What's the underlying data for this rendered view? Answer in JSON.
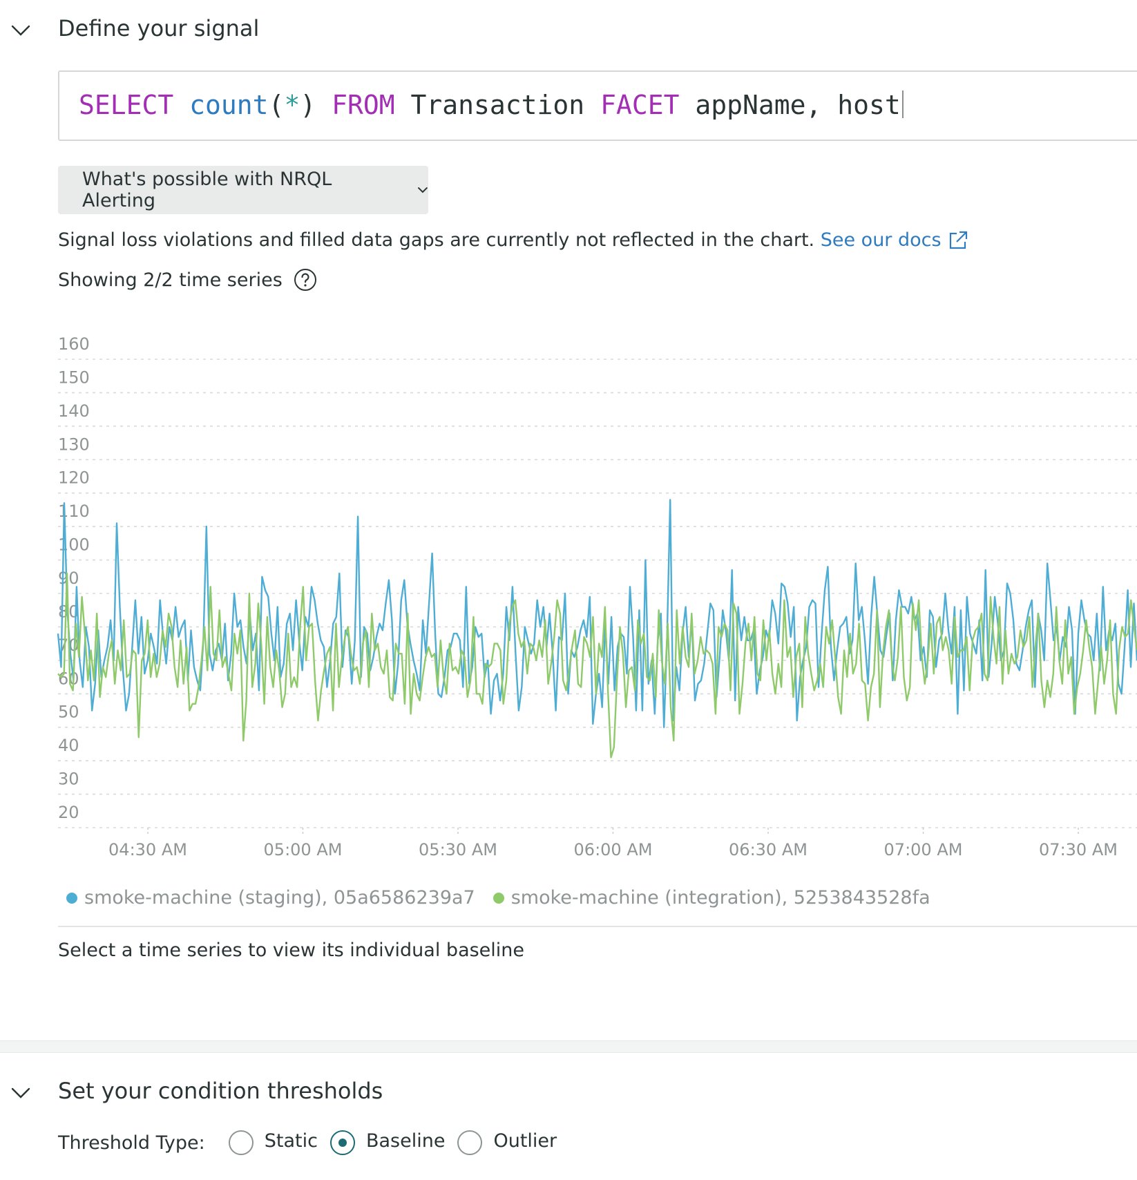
{
  "signal_section": {
    "title": "Define your signal",
    "query": {
      "t1": "SELECT",
      "t2": "count",
      "t3": "(",
      "t4": "*",
      "t5": ")",
      "t6": "FROM",
      "t7": "Transaction",
      "t8": "FACET",
      "t9": "appName, host"
    },
    "nrql_button": "What's possible with NRQL Alerting",
    "note_text": "Signal loss violations and filled data gaps are currently not reflected in the chart.",
    "docs_link": "See our docs",
    "showing_text": "Showing 2/2 time series",
    "select_hint": "Select a time series to view its individual baseline"
  },
  "threshold_section": {
    "title": "Set your condition thresholds",
    "type_label": "Threshold Type:",
    "options": [
      {
        "label": "Static",
        "checked": false
      },
      {
        "label": "Baseline",
        "checked": true
      },
      {
        "label": "Outlier",
        "checked": false
      }
    ]
  },
  "chart_data": {
    "type": "line",
    "y_ticks": [
      "160",
      "150",
      "140",
      "130",
      "120",
      "110",
      "100",
      "90",
      "80",
      "70",
      "60",
      "50",
      "40",
      "30",
      "20"
    ],
    "ylim": [
      20,
      160
    ],
    "x_ticks": [
      "04:30 AM",
      "05:00 AM",
      "05:30 AM",
      "06:00 AM",
      "06:30 AM",
      "07:00 AM",
      "07:30 AM"
    ],
    "grid": true,
    "legend_position": "bottom",
    "series": [
      {
        "name": "smoke-machine (staging), 05a6586239a7",
        "color": "#4eadd4",
        "values": [
          78,
          68,
          117,
          85,
          72,
          64,
          92,
          70,
          62,
          80,
          74,
          55,
          63,
          79,
          65,
          70,
          74,
          82,
          70,
          111,
          86,
          67,
          55,
          60,
          74,
          88,
          72,
          83,
          66,
          70,
          78,
          74,
          69,
          88,
          77,
          69,
          80,
          76,
          86,
          77,
          80,
          82,
          64,
          79,
          68,
          64,
          61,
          76,
          110,
          72,
          67,
          73,
          75,
          70,
          81,
          64,
          72,
          90,
          80,
          82,
          74,
          69,
          84,
          73,
          78,
          61,
          95,
          91,
          89,
          78,
          70,
          86,
          65,
          69,
          81,
          84,
          73,
          88,
          76,
          67,
          83,
          80,
          92,
          88,
          81,
          76,
          74,
          62,
          70,
          81,
          83,
          96,
          68,
          79,
          77,
          63,
          76,
          113,
          65,
          80,
          78,
          67,
          71,
          77,
          81,
          79,
          87,
          94,
          82,
          60,
          69,
          88,
          94,
          81,
          75,
          70,
          66,
          61,
          82,
          72,
          87,
          102,
          78,
          60,
          59,
          65,
          73,
          74,
          78,
          78,
          76,
          62,
          92,
          63,
          68,
          80,
          77,
          78,
          65,
          70,
          54,
          64,
          66,
          58,
          66,
          86,
          76,
          92,
          72,
          55,
          62,
          80,
          76,
          72,
          75,
          88,
          80,
          86,
          74,
          84,
          72,
          55,
          77,
          76,
          90,
          60,
          73,
          71,
          74,
          79,
          82,
          77,
          89,
          51,
          60,
          66,
          56,
          81,
          63,
          83,
          61,
          74,
          78,
          77,
          66,
          92,
          77,
          55,
          85,
          55,
          100,
          63,
          70,
          54,
          76,
          84,
          50,
          77,
          118,
          52,
          68,
          61,
          78,
          86,
          71,
          82,
          58,
          63,
          64,
          69,
          78,
          87,
          85,
          59,
          71,
          85,
          79,
          70,
          97,
          58,
          86,
          76,
          83,
          76,
          76,
          79,
          60,
          67,
          71,
          79,
          76,
          88,
          84,
          75,
          93,
          92,
          87,
          77,
          86,
          52,
          65,
          70,
          74,
          86,
          88,
          87,
          62,
          78,
          91,
          98,
          74,
          64,
          73,
          80,
          81,
          83,
          72,
          76,
          99,
          82,
          86,
          76,
          63,
          83,
          95,
          84,
          73,
          71,
          78,
          84,
          64,
          82,
          91,
          86,
          86,
          84,
          89,
          82,
          84,
          70,
          74,
          65,
          85,
          83,
          68,
          76,
          78,
          90,
          79,
          72,
          86,
          54,
          85,
          61,
          89,
          78,
          75,
          72,
          82,
          64,
          97,
          65,
          75,
          89,
          81,
          70,
          73,
          93,
          90,
          82,
          69,
          67,
          73,
          80,
          85,
          88,
          62,
          84,
          79,
          70,
          99,
          88,
          76,
          80,
          70,
          77,
          74,
          86,
          79,
          54,
          78,
          88,
          82,
          78,
          77,
          70,
          84,
          67,
          92,
          73,
          79,
          76,
          81,
          63,
          60,
          74,
          91,
          68,
          87,
          70
        ]
      },
      {
        "name": "smoke-machine (integration), 5253843528fa",
        "color": "#8ec96a",
        "values": [
          66,
          65,
          66,
          96,
          63,
          61,
          81,
          71,
          89,
          78,
          64,
          73,
          64,
          84,
          59,
          68,
          65,
          72,
          76,
          63,
          73,
          67,
          82,
          65,
          66,
          73,
          72,
          47,
          70,
          72,
          82,
          65,
          72,
          65,
          69,
          79,
          74,
          84,
          80,
          68,
          62,
          76,
          63,
          74,
          55,
          57,
          57,
          62,
          70,
          80,
          67,
          92,
          72,
          70,
          85,
          68,
          71,
          66,
          61,
          78,
          72,
          79,
          46,
          58,
          90,
          62,
          69,
          87,
          75,
          57,
          83,
          68,
          62,
          73,
          67,
          56,
          60,
          78,
          62,
          65,
          62,
          80,
          92,
          70,
          80,
          81,
          64,
          52,
          61,
          67,
          72,
          74,
          55,
          81,
          62,
          71,
          77,
          80,
          72,
          67,
          68,
          63,
          75,
          79,
          62,
          84,
          73,
          75,
          68,
          66,
          73,
          59,
          58,
          75,
          72,
          72,
          57,
          84,
          54,
          66,
          60,
          58,
          65,
          71,
          74,
          71,
          72,
          62,
          76,
          65,
          60,
          75,
          67,
          68,
          66,
          73,
          71,
          59,
          64,
          83,
          60,
          60,
          57,
          69,
          68,
          69,
          75,
          75,
          73,
          57,
          64,
          81,
          86,
          88,
          78,
          74,
          76,
          66,
          75,
          74,
          70,
          76,
          71,
          82,
          63,
          69,
          77,
          88,
          84,
          64,
          61,
          67,
          74,
          79,
          63,
          62,
          77,
          75,
          71,
          83,
          60,
          75,
          71,
          86,
          61,
          41,
          44,
          64,
          80,
          72,
          56,
          67,
          68,
          61,
          82,
          75,
          78,
          65,
          64,
          72,
          59,
          85,
          70,
          63,
          81,
          56,
          46,
          85,
          69,
          80,
          71,
          68,
          84,
          66,
          70,
          77,
          72,
          73,
          72,
          69,
          54,
          80,
          77,
          81,
          79,
          61,
          87,
          84,
          54,
          63,
          75,
          81,
          70,
          83,
          66,
          64,
          82,
          70,
          79,
          66,
          60,
          69,
          62,
          88,
          71,
          74,
          59,
          71,
          75,
          56,
          83,
          72,
          66,
          61,
          64,
          69,
          62,
          80,
          75,
          82,
          71,
          59,
          54,
          73,
          65,
          78,
          66,
          69,
          81,
          64,
          63,
          52,
          62,
          66,
          85,
          56,
          72,
          80,
          85,
          69,
          64,
          71,
          86,
          65,
          58,
          62,
          87,
          79,
          88,
          71,
          63,
          70,
          81,
          66,
          81,
          83,
          73,
          77,
          73,
          63,
          83,
          71,
          73,
          73,
          77,
          61,
          76,
          79,
          80,
          84,
          66,
          64,
          89,
          77,
          69,
          86,
          63,
          79,
          66,
          72,
          69,
          71,
          79,
          74,
          76,
          83,
          62,
          74,
          84,
          64,
          56,
          64,
          59,
          66,
          86,
          70,
          63,
          82,
          66,
          71,
          54,
          62,
          66,
          73,
          82,
          74,
          68,
          54,
          64,
          74,
          63,
          70,
          82,
          60,
          54,
          73,
          80,
          77,
          78,
          88,
          80,
          73
        ]
      }
    ]
  }
}
